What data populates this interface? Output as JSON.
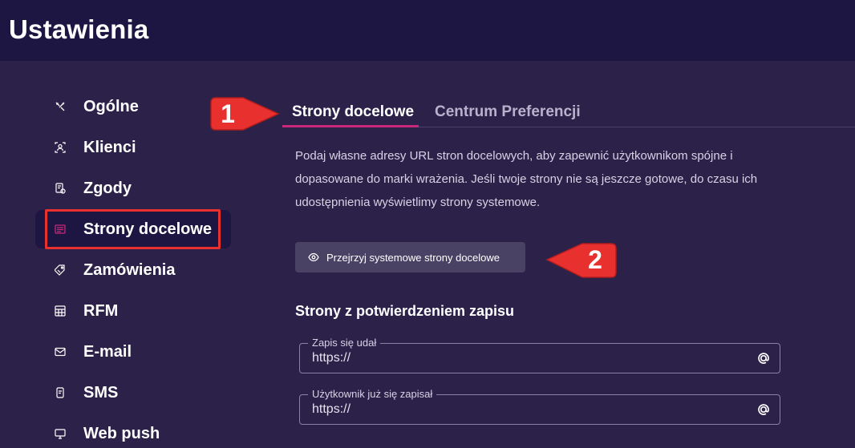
{
  "header": {
    "title": "Ustawienia"
  },
  "sidebar": {
    "items": [
      {
        "label": "Ogólne",
        "icon": "tools-icon"
      },
      {
        "label": "Klienci",
        "icon": "contact-card-icon"
      },
      {
        "label": "Zgody",
        "icon": "consent-icon"
      },
      {
        "label": "Strony docelowe",
        "icon": "landing-page-icon",
        "active": true
      },
      {
        "label": "Zamówienia",
        "icon": "order-tag-icon"
      },
      {
        "label": "RFM",
        "icon": "rfm-table-icon"
      },
      {
        "label": "E-mail",
        "icon": "envelope-icon"
      },
      {
        "label": "SMS",
        "icon": "sms-icon"
      },
      {
        "label": "Web push",
        "icon": "web-push-icon"
      }
    ]
  },
  "tabs": [
    {
      "label": "Strony docelowe",
      "active": true
    },
    {
      "label": "Centrum Preferencji",
      "active": false
    }
  ],
  "main": {
    "description": "Podaj własne adresy URL stron docelowych, aby zapewnić użytkownikom spójne i dopasowane do marki wrażenia. Jeśli twoje strony nie są jeszcze gotowe, do czasu ich udostępnienia wyświetlimy strony systemowe.",
    "preview_button": "Przejrzyj systemowe strony docelowe",
    "section_title": "Strony z potwierdzeniem zapisu",
    "fields": [
      {
        "label": "Zapis się udał",
        "value": "https://"
      },
      {
        "label": "Użytkownik już się zapisał",
        "value": "https://"
      }
    ]
  },
  "callouts": [
    {
      "number": "1"
    },
    {
      "number": "2"
    }
  ],
  "colors": {
    "background": "#2c2149",
    "header_bg": "#1e1642",
    "accent": "#c8287a",
    "callout_red": "#e8302f",
    "button_bg": "#4a4264"
  }
}
